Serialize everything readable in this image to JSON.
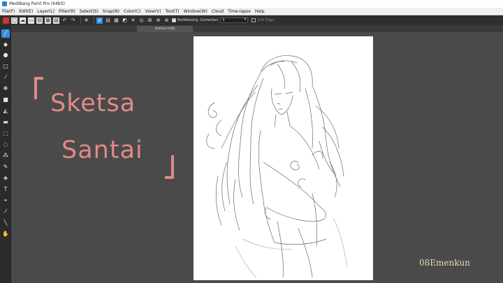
{
  "window": {
    "title": "MediBang Paint Pro (64bit)"
  },
  "menu": [
    "File(F)",
    "Edit(E)",
    "Layer(L)",
    "Filter(R)",
    "Select(S)",
    "Snap(N)",
    "Color(C)",
    "View(V)",
    "Tool(T)",
    "Window(W)",
    "Cloud",
    "Time-lapse",
    "Help"
  ],
  "toolbar": {
    "antialiasing_label": "AntiAliasing",
    "correction_label": "Correction",
    "correction_value": "0",
    "soft_edge_label": "Soft Edge"
  },
  "document": {
    "tab_name": "sketsa.mdp"
  },
  "overlay": {
    "line1": "Sketsa",
    "line2": "Santai",
    "watermark": "08Emenkun"
  },
  "colors": {
    "accent": "#2f8ee0",
    "overlay_text": "#e08a86",
    "watermark": "#e8d9b4",
    "workspace": "#4a4a4a"
  },
  "icons": [
    "brush-icon",
    "eraser-icon",
    "dot-icon",
    "rectangle-icon",
    "blur-icon",
    "move-icon",
    "fill-rect-icon",
    "bucket-icon",
    "gradient-icon",
    "select-rect-icon",
    "lasso-icon",
    "magic-wand-icon",
    "select-pen-icon",
    "select-eraser-icon",
    "text-icon",
    "operation-icon",
    "eyedropper-icon",
    "dropper-icon",
    "hand-icon"
  ]
}
